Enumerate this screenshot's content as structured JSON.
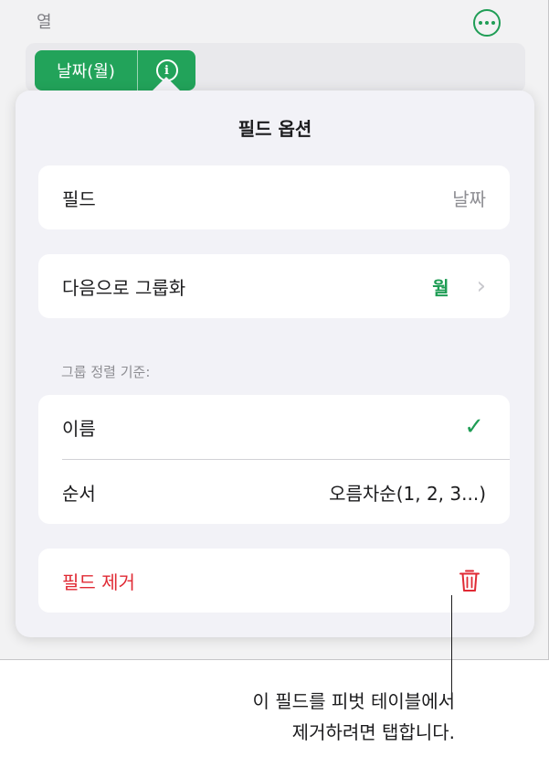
{
  "header": {
    "column_label": "열",
    "more_icon": "ellipsis-circle-icon"
  },
  "field_chip": {
    "label": "날짜(월)",
    "info_icon": "info-icon"
  },
  "popover": {
    "title": "필드 옵션",
    "field_row": {
      "label": "필드",
      "value": "날짜"
    },
    "group_row": {
      "label": "다음으로 그룹화",
      "value": "월"
    },
    "sort_section_header": "그룹 정렬 기준:",
    "sort_rows": [
      {
        "label": "이름",
        "value": "",
        "selected": true
      },
      {
        "label": "순서",
        "value": "오름차순(1, 2, 3...)",
        "selected": false
      }
    ],
    "remove_label": "필드 제거"
  },
  "callout": {
    "line1": "이 필드를 피벗 테이블에서",
    "line2": "제거하려면 탭합니다."
  },
  "colors": {
    "accent": "#22a35a",
    "destructive": "#e02a34"
  }
}
